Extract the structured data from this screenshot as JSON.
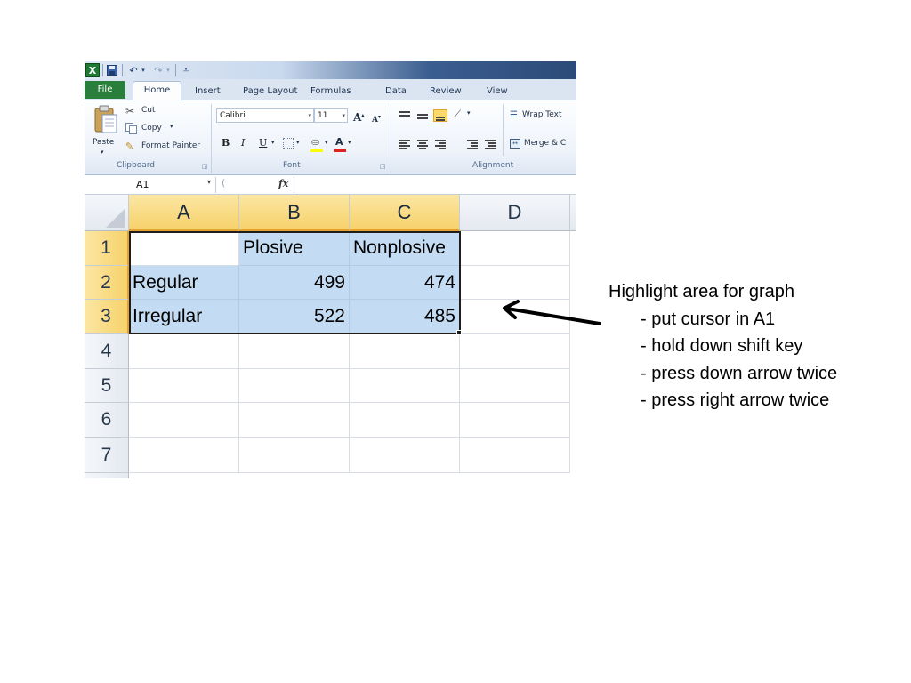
{
  "app": {
    "logo": "X"
  },
  "ribbon_tabs": [
    "File",
    "Home",
    "Insert",
    "Page Layout",
    "Formulas",
    "Data",
    "Review",
    "View"
  ],
  "clipboard": {
    "title": "Clipboard",
    "paste": "Paste",
    "cut": "Cut",
    "copy": "Copy",
    "format_painter": "Format Painter"
  },
  "font": {
    "title": "Font",
    "name": "Calibri",
    "size": "11",
    "bold": "B",
    "italic": "I",
    "underline": "U"
  },
  "alignment": {
    "title": "Alignment",
    "wrap_text": "Wrap Text",
    "merge": "Merge & C"
  },
  "formula_bar": {
    "name_box": "A1",
    "fx": "fx",
    "formula": ""
  },
  "sheet": {
    "columns": [
      "A",
      "B",
      "C",
      "D"
    ],
    "rows": [
      "1",
      "2",
      "3",
      "4",
      "5",
      "6",
      "7"
    ],
    "cells": {
      "B1": "Plosive",
      "C1": "Nonplosive",
      "A2": "Regular",
      "B2": "499",
      "C2": "474",
      "A3": "Irregular",
      "B3": "522",
      "C3": "485"
    }
  },
  "instructions": {
    "title": "Highlight area for graph",
    "steps": [
      "- put cursor in A1",
      "- hold down shift key",
      "- press down arrow twice",
      "- press right arrow twice"
    ]
  },
  "colors": {
    "selection_fill": "#c4dcf3",
    "header_selected": "#f7d26b",
    "file_tab": "#2a7e3b"
  }
}
